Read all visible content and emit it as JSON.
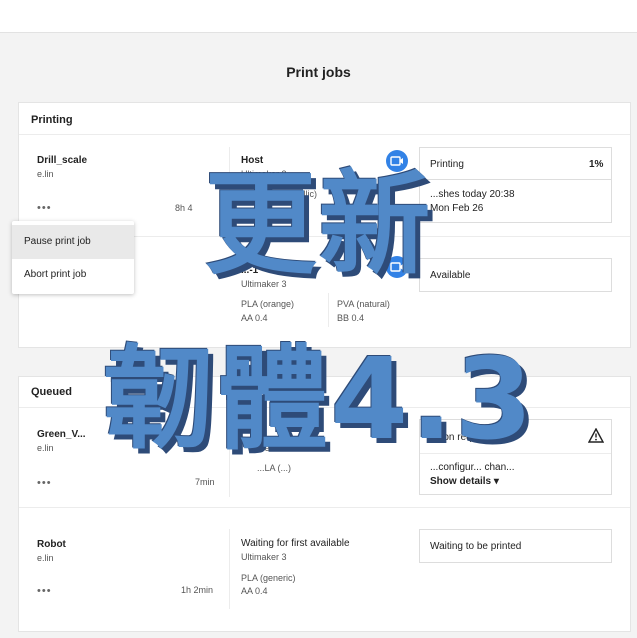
{
  "page": {
    "title": "Print jobs"
  },
  "printing": {
    "section_label": "Printing",
    "jobs": [
      {
        "name": "Drill_scale",
        "owner": "e.lin",
        "duration": "8h 4",
        "printer_label": "Host",
        "printer_model": "Ultimaker 3",
        "material_1": "(silver metallic)",
        "material_1_core": "BB",
        "status": "Printing",
        "progress": "1%",
        "finish_line": "...shes today 20:38",
        "date": "Mon Feb 26"
      },
      {
        "printer_label": "...-1",
        "printer_model": "Ultimaker 3",
        "material_1": "PLA (orange)",
        "material_1_core": "AA 0.4",
        "material_2": "PVA (natural)",
        "material_2_core": "BB 0.4",
        "status": "Available"
      }
    ]
  },
  "context_menu": {
    "items": [
      "Pause print job",
      "Abort print job"
    ]
  },
  "queued": {
    "section_label": "Queued",
    "jobs": [
      {
        "name": "Green_V...",
        "owner": "e.lin",
        "duration": "7min",
        "printer_label": "...ener...",
        "material_1": "...LA (...)",
        "status": "...tion required",
        "status_detail": "...configur... chan...",
        "show_details": "Show details"
      },
      {
        "name": "Robot",
        "owner": "e.lin",
        "duration": "1h 2min",
        "printer_label": "Waiting for first available",
        "printer_model": "Ultimaker 3",
        "material_1": "PLA (generic)",
        "material_1_core": "AA 0.4",
        "status": "Waiting to be printed"
      }
    ]
  },
  "overlay": {
    "line1": "更新",
    "line2": "韌體4.3"
  },
  "icons": {
    "more": "more-dots-icon",
    "camera": "camera-icon",
    "warning": "warning-icon"
  },
  "colors": {
    "accent": "#3282e6",
    "overlay": "#5189c8"
  }
}
